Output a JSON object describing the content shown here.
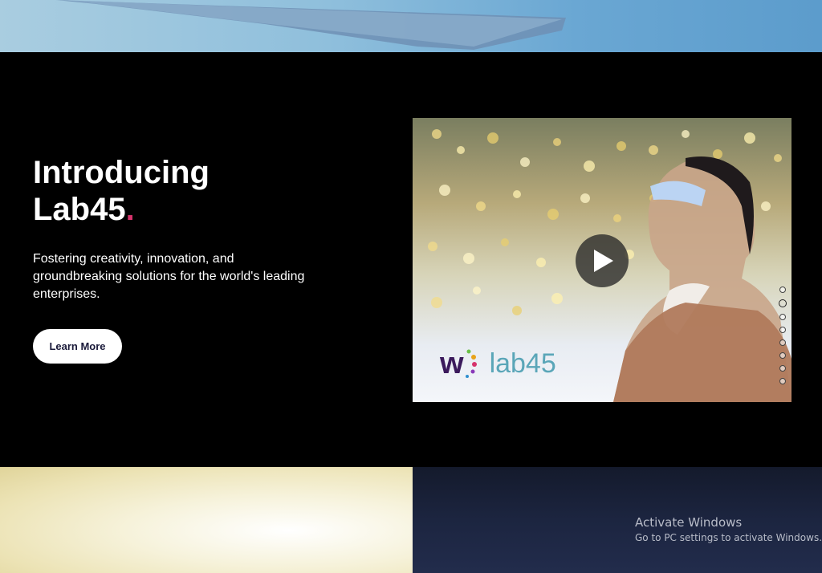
{
  "hero": {
    "title_line1": "Introducing",
    "title_line2": "Lab45",
    "title_dot": ".",
    "description": "Fostering creativity, innovation, and groundbreaking solutions for the world's leading enterprises.",
    "cta_label": "Learn More"
  },
  "video": {
    "logo_mark": "w",
    "logo_text": "lab45",
    "play_icon": "play-icon"
  },
  "carousel": {
    "dot_count": 8,
    "active_index": 1
  },
  "watermark": {
    "title": "Activate Windows",
    "subtitle": "Go to PC settings to activate Windows."
  },
  "colors": {
    "accent_dot": "#d6336c",
    "logo_purple": "#3b1a5c",
    "logo_teal": "#5aa6b8"
  }
}
